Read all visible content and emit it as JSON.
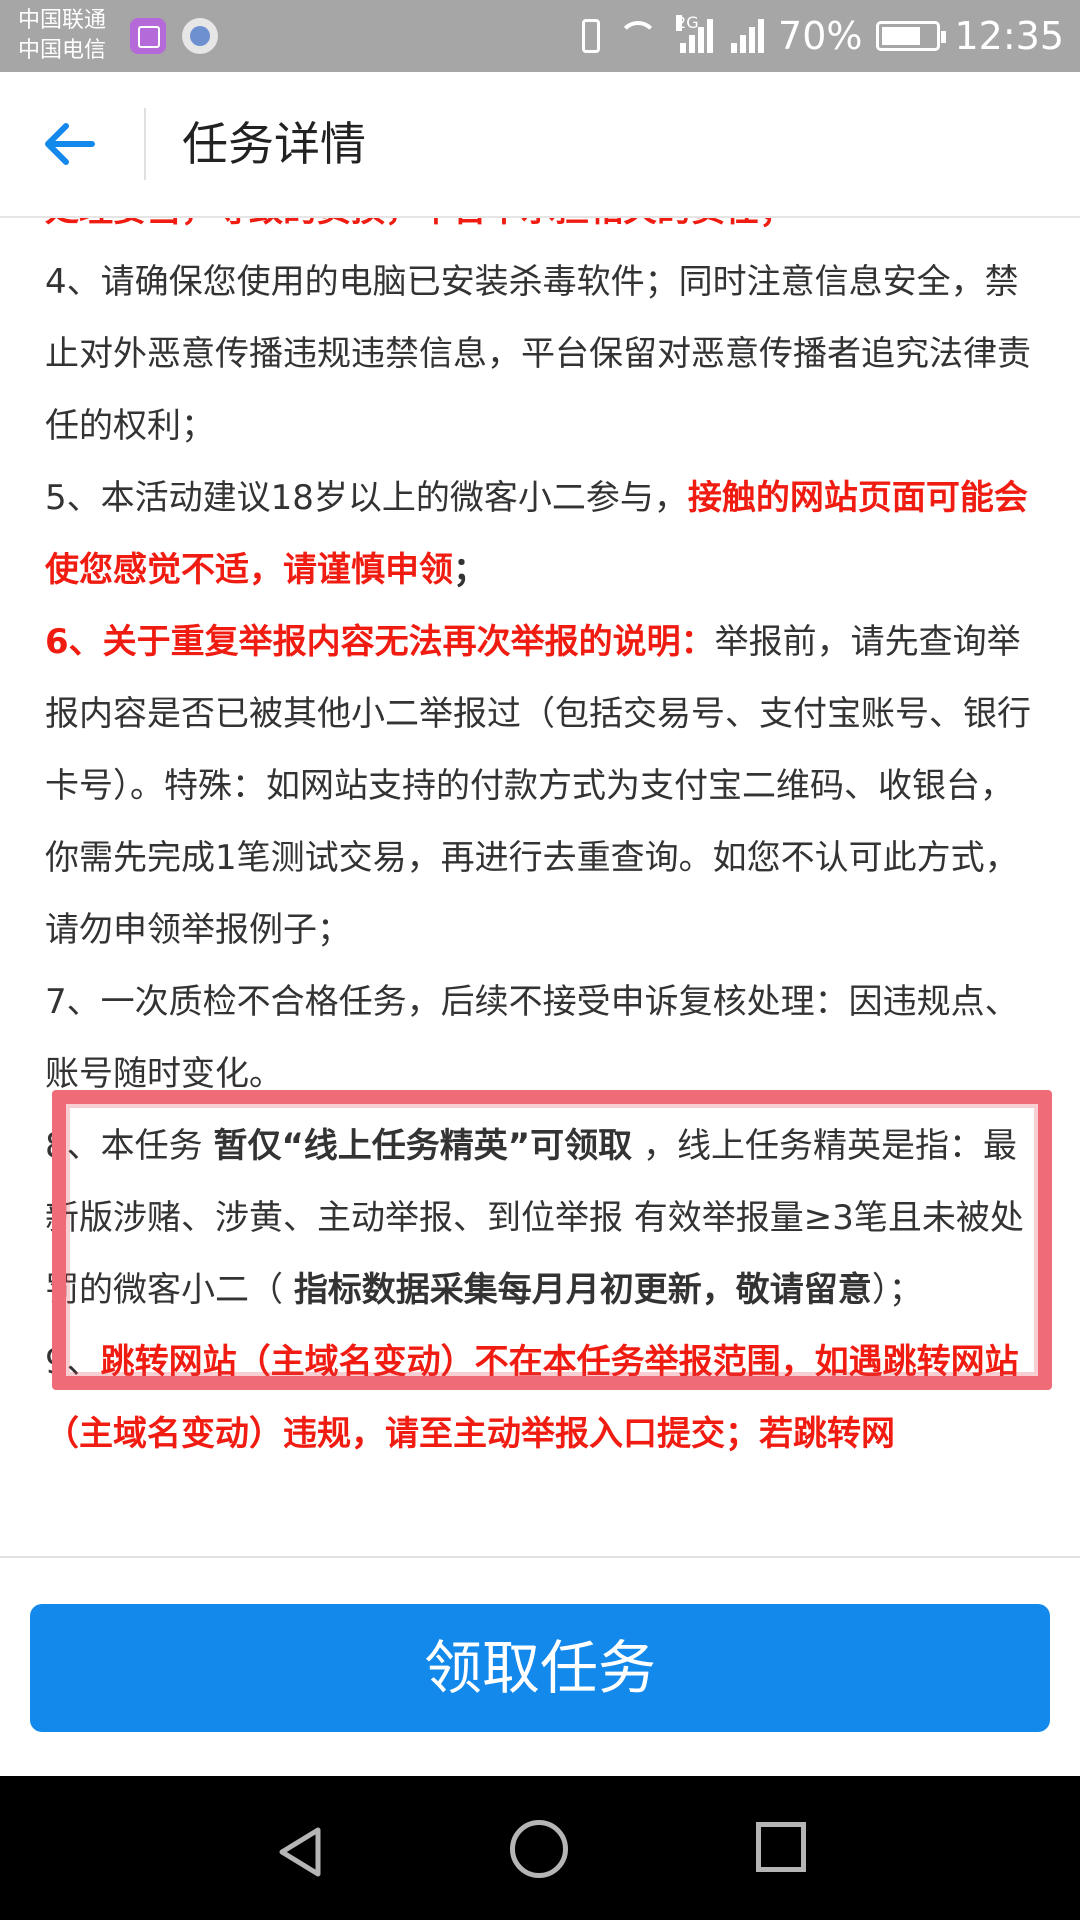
{
  "status_bar": {
    "carrier_1": "中国联通",
    "carrier_2": "中国电信",
    "signal_1_tag": "2G",
    "signal_2_tag": "3G\n2G",
    "battery_percent": "70%",
    "time": "12:35",
    "battery_level": 0.7
  },
  "header": {
    "back_icon": "arrow-left-icon",
    "title": "任务详情"
  },
  "content": {
    "p3_tail": "处理妥当，导致的资损，平台不承担相关的责任；",
    "p4": "4、请确保您使用的电脑已安装杀毒软件；同时注意信息安全，禁止对外恶意传播违规违禁信息，平台保留对恶意传播者追究法律责任的权利；",
    "p5_prefix": "5、本活动建议18岁以上的微客小二参与，",
    "p5_red": "接触的网站页面可能会使您感觉不适，请谨慎申领",
    "p5_suffix": "；",
    "p6_red": "6、关于重复举报内容无法再次举报的说明：",
    "p6_text": "举报前，请先查询举报内容是否已被其他小二举报过（包括交易号、支付宝账号、银行卡号）。特殊：如网站支持的付款方式为支付宝二维码、收银台，你需先完成1笔测试交易，再进行去重查询。如您不认可此方式，请勿申领举报例子；",
    "p7": "7、一次质检不合格任务，后续不接受申诉复核处理：因违规点、账号随时变化。",
    "p8_prefix": "8、本任务 ",
    "p8_bold": "暂仅“线上任务精英”可领取",
    "p8_mid": " ，线上任务精英是指：最新版涉赌、涉黄、主动举报、到位举报 有效举报量≥3笔且未被处罚的微客小二（ ",
    "p8_bold2": "指标数据采集每月月初更新，敬请留意",
    "p8_suffix": "）；",
    "p9_prefix": "9、",
    "p9_red": "跳转网站（主域名变动）不在本任务举报范围，如遇跳转网站（主域名变动）违规，请至主动举报入口提交；若跳转网"
  },
  "action": {
    "claim_label": "领取任务"
  },
  "colors": {
    "accent": "#1389eb",
    "warning_red": "#f01c12",
    "highlight_box": "#f06b78"
  }
}
